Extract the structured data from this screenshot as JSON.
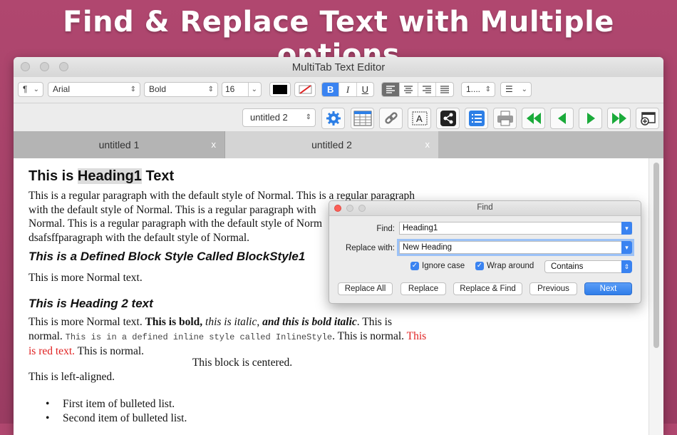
{
  "headline": "Find & Replace Text with Multiple options",
  "window": {
    "title": "MultiTab Text Editor"
  },
  "format_bar": {
    "paragraph_style": "¶",
    "font": "Arial",
    "weight": "Bold",
    "size": "16",
    "bold": "B",
    "italic": "I",
    "underline": "U",
    "line_spacing": "1....",
    "list_style": "☰"
  },
  "toolbar": {
    "document_select": "untitled 2"
  },
  "tabs": [
    {
      "label": "untitled 1",
      "close": "x"
    },
    {
      "label": "untitled 2",
      "close": "x"
    }
  ],
  "document": {
    "h1_pre": "This is ",
    "h1_highlight": "Heading1",
    "h1_post": " Text",
    "para1_line1": "This is a regular paragraph with the default style of Normal. This is a regular paragraph",
    "para1_line2": "with the default style of Normal. This is a regular paragraph with",
    "para1_line3": "Normal. This is a regular paragraph with the default style of Norm",
    "para1_line4": "dsafsffparagraph with the default style of Normal.",
    "block_style": "This is a Defined Block Style Called BlockStyle1",
    "more_normal": "This is more Normal text.",
    "h2": "This is Heading 2 text",
    "mixed_a": "This is more Normal text. ",
    "mixed_bold": "This is bold, ",
    "mixed_italic": "this is italic",
    "mixed_comma": ", ",
    "mixed_bolditalic": "and this is bold italic",
    "mixed_b": ". This is",
    "normal_word": "normal. ",
    "inline_style": "This is in a defined inline style called InlineStyle",
    "normal_after": ". This is normal. ",
    "red_1": "This",
    "red_2": "is red text.",
    "normal_end": " This is normal.",
    "centered": "This block is centered.",
    "left_aligned": "This is left-aligned.",
    "bullets": [
      "First item of bulleted list.",
      "Second item of bulleted list."
    ]
  },
  "find_dialog": {
    "title": "Find",
    "find_label": "Find:",
    "find_value": "Heading1",
    "replace_label": "Replace with:",
    "replace_value": "New Heading",
    "ignore_case": "Ignore case",
    "wrap_around": "Wrap around",
    "match_mode": "Contains",
    "buttons": {
      "replace_all": "Replace All",
      "replace": "Replace",
      "replace_find": "Replace & Find",
      "previous": "Previous",
      "next": "Next"
    }
  },
  "colors": {
    "accent_blue": "#3a83f1",
    "red_text": "#e02020",
    "background": "#a84169",
    "green_nav": "#1aaa3a"
  }
}
